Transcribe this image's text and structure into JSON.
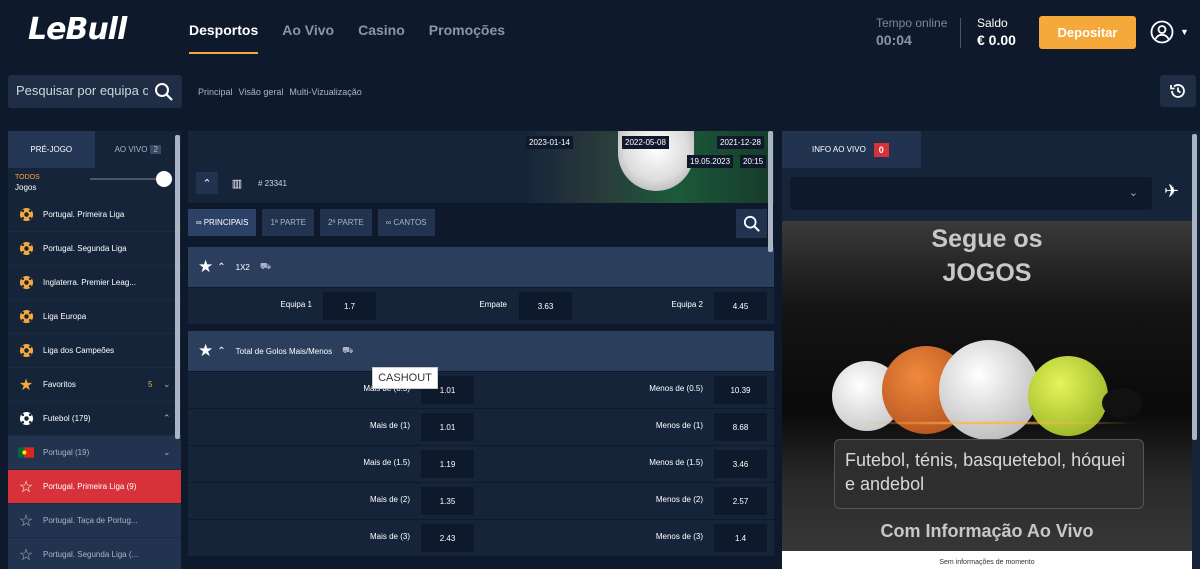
{
  "brand": {
    "logo": "LeBull",
    "accent": "#f5a93b",
    "live_red": "#d7313a"
  },
  "nav": {
    "items": [
      "Desportos",
      "Ao Vivo",
      "Casino",
      "Promoções"
    ],
    "active": 0
  },
  "session": {
    "label": "Tempo online",
    "value": "00:04"
  },
  "balance": {
    "label": "Saldo",
    "value": "€ 0.00"
  },
  "deposit": {
    "label": "Depositar"
  },
  "search": {
    "placeholder": "Pesquisar por equipa ou"
  },
  "subnav": [
    "Principal",
    "Visão geral",
    "Multi-Vizualização"
  ],
  "left": {
    "tabs": [
      {
        "label": "PRÉ-JOGO"
      },
      {
        "label": "AO VIVO",
        "count": "2"
      }
    ],
    "todos": {
      "label": "TODOS",
      "sub": "Jogos"
    },
    "items": [
      {
        "label": "Portugal. Primeira Liga",
        "icon": "soccer-ball-icon"
      },
      {
        "label": "Portugal. Segunda Liga",
        "icon": "soccer-ball-icon"
      },
      {
        "label": "Inglaterra. Premier Leag...",
        "icon": "soccer-ball-icon"
      },
      {
        "label": "Liga Europa",
        "icon": "soccer-ball-icon"
      },
      {
        "label": "Liga dos Campeões",
        "icon": "soccer-ball-icon"
      },
      {
        "label": "Favoritos",
        "count": "5",
        "icon": "star-icon"
      },
      {
        "label": "Futebol (179)",
        "icon": "soccer-ball-icon"
      },
      {
        "label": "Portugal (19)",
        "icon": "portugal-flag-icon"
      },
      {
        "label": "Portugal. Primeira Liga (9)",
        "icon": "star-outline-icon"
      },
      {
        "label": "Portugal. Taça de Portug...",
        "icon": "star-outline-icon"
      },
      {
        "label": "Portugal. Segunda Liga (...",
        "icon": "star-outline-icon"
      }
    ]
  },
  "event": {
    "dates": [
      "2023-01-14",
      "2022-05-08",
      "2021-12-28"
    ],
    "date": "19.05.2023",
    "time": "20:15",
    "id": "# 23341"
  },
  "market_tabs": [
    "PRINCIPAIS",
    "1ª PARTE",
    "2ª PARTE",
    "CANTOS"
  ],
  "markets": {
    "m1x2": {
      "title": "1X2",
      "odds": [
        {
          "label": "Equipa 1",
          "value": "1.7"
        },
        {
          "label": "Empate",
          "value": "3.63"
        },
        {
          "label": "Equipa 2",
          "value": "4.45"
        }
      ]
    },
    "totals": {
      "title": "Total de Golos Mais/Menos",
      "rows": [
        {
          "over_label": "Mais de (0.5)",
          "over": "1.01",
          "under_label": "Menos de (0.5)",
          "under": "10.39"
        },
        {
          "over_label": "Mais de (1)",
          "over": "1.01",
          "under_label": "Menos de (1)",
          "under": "8.68"
        },
        {
          "over_label": "Mais de (1.5)",
          "over": "1.19",
          "under_label": "Menos de (1.5)",
          "under": "3.46"
        },
        {
          "over_label": "Mais de (2)",
          "over": "1.35",
          "under_label": "Menos de (2)",
          "under": "2.57"
        },
        {
          "over_label": "Mais de (3)",
          "over": "2.43",
          "under_label": "Menos de (3)",
          "under": "1.4"
        }
      ]
    }
  },
  "tooltip": "CASHOUT",
  "right": {
    "tab": "INFO AO VIVO",
    "count": "0",
    "promo_line1": "Segue os",
    "promo_line2": "JOGOS",
    "promo_desc": "Futebol, ténis, basquetebol, hóquei e andebol",
    "promo_footer": "Com Informação Ao Vivo",
    "no_info": "Sem informações de momento"
  }
}
